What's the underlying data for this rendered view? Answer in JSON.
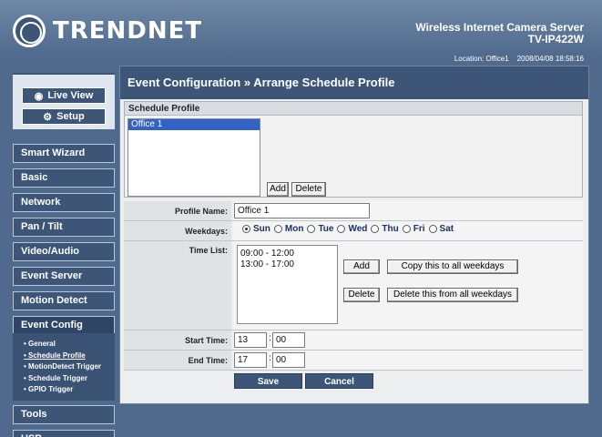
{
  "header": {
    "brand": "TRENDNET",
    "product_line": "Wireless Internet Camera Server",
    "model": "TV-IP422W",
    "location_text": "Location: Office1",
    "datetime_text": "2008/04/08 18:58:16"
  },
  "mode": {
    "live_view": "Live View",
    "setup": "Setup"
  },
  "nav": {
    "items": [
      "Smart Wizard",
      "Basic",
      "Network",
      "Pan / Tilt",
      "Video/Audio",
      "Event Server",
      "Motion Detect",
      "Event Config",
      "Tools",
      "USB"
    ],
    "active": "Event Config",
    "submenu": [
      "• General",
      "• Schedule Profile",
      "• MotionDetect Trigger",
      "• Schedule Trigger",
      "• GPIO Trigger"
    ],
    "submenu_active": "• Schedule Profile"
  },
  "page": {
    "title": "Event Configuration » Arrange Schedule Profile"
  },
  "schedule_profile": {
    "heading": "Schedule Profile",
    "profiles": [
      "Office 1"
    ],
    "selected": "Office 1",
    "add_label": "Add",
    "delete_label": "Delete"
  },
  "form": {
    "profile_name_label": "Profile Name:",
    "profile_name_value": "Office 1",
    "weekdays_label": "Weekdays:",
    "weekdays": [
      "Sun",
      "Mon",
      "Tue",
      "Wed",
      "Thu",
      "Fri",
      "Sat"
    ],
    "weekday_selected": "Sun",
    "time_list_label": "Time List:",
    "time_list": [
      "09:00 - 12:00",
      "13:00 - 17:00"
    ],
    "add_label": "Add",
    "copy_label": "Copy this to all weekdays",
    "delete_label": "Delete",
    "delete_all_label": "Delete this from all weekdays",
    "start_time_label": "Start Time:",
    "start_hour": "13",
    "start_minute": "00",
    "end_time_label": "End Time:",
    "end_hour": "17",
    "end_minute": "00",
    "save_label": "Save",
    "cancel_label": "Cancel"
  },
  "colors": {
    "header_bg": "#4f6a8c",
    "nav_bg": "#3d5678",
    "selection": "#3163c6"
  }
}
